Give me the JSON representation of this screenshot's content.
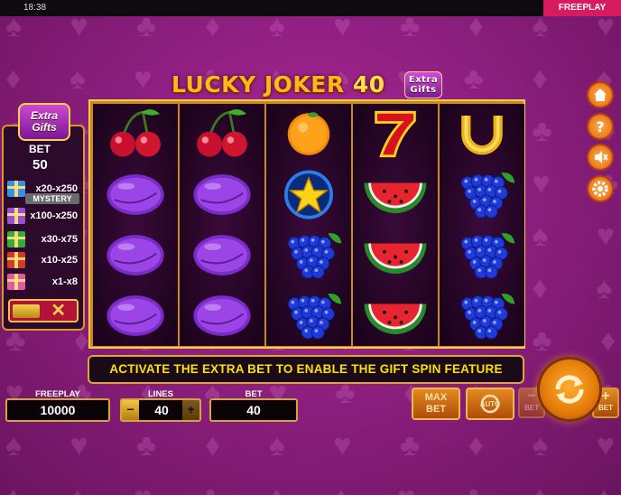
{
  "status_bar": {
    "clock": "18:38",
    "mode_badge": "FREEPLAY"
  },
  "title": {
    "main": "LUCKY JOKER ",
    "number": "40",
    "badge_line1": "Extra",
    "badge_line2": "Gifts"
  },
  "extra_gifts_panel": {
    "logo_line1": "Extra",
    "logo_line2": "Gifts",
    "bet_label": "BET",
    "bet_value": "50",
    "mystery_label": "MYSTERY",
    "rows": [
      {
        "gift_color": "#3b8fe0",
        "multiplier": "x20-x250"
      },
      {
        "gift_color": "#9b4fd6",
        "multiplier": "x100-x250"
      },
      {
        "gift_color": "#3aa83a",
        "multiplier": "x30-x75"
      },
      {
        "gift_color": "#d43a2a",
        "multiplier": "x10-x25"
      },
      {
        "gift_color": "#e05aa8",
        "multiplier": "x1-x8"
      }
    ],
    "toggle_close": "✕"
  },
  "reels": [
    [
      "cherries",
      "plum",
      "plum",
      "plum"
    ],
    [
      "cherries",
      "plum",
      "plum",
      "plum"
    ],
    [
      "orange",
      "star",
      "grapes",
      "grapes"
    ],
    [
      "seven",
      "watermelon",
      "watermelon",
      "watermelon"
    ],
    [
      "horseshoe",
      "grapes",
      "grapes",
      "grapes"
    ]
  ],
  "message": "ACTIVATE THE EXTRA BET TO ENABLE THE GIFT SPIN FEATURE",
  "controls": {
    "balance_label": "FREEPLAY",
    "balance_value": "10000",
    "lines_label": "LINES",
    "lines_value": "40",
    "lines_minus": "−",
    "lines_plus": "+",
    "bet_label": "BET",
    "bet_value": "40",
    "max_bet_line1": "MAX",
    "max_bet_line2": "BET",
    "auto_label": "AUTO",
    "bet_minus_symbol": "−",
    "bet_minus_label": "BET",
    "bet_plus_symbol": "+",
    "bet_plus_label": "BET"
  },
  "side_menu": [
    "home-icon",
    "help-icon",
    "sound-off-icon",
    "settings-icon"
  ],
  "colors": {
    "background": "#8e1f80",
    "frame_gold": "#d6a53a",
    "message_text": "#ffe000",
    "accent_orange": "#e47b09"
  }
}
